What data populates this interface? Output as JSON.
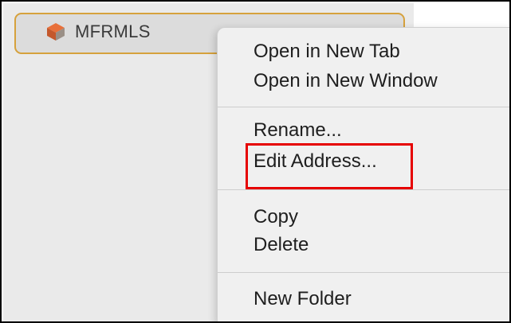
{
  "sidebar": {
    "bookmark": {
      "label": "MFRMLS",
      "icon": "mfrmls-logo-icon",
      "selected_border_color": "#d6a13c"
    }
  },
  "context_menu": {
    "groups": [
      {
        "items": [
          "Open in New Tab",
          "Open in New Window"
        ]
      },
      {
        "items": [
          "Rename...",
          "Edit Address..."
        ]
      },
      {
        "items": [
          "Copy",
          "Delete"
        ]
      },
      {
        "items": [
          "New Folder"
        ]
      }
    ]
  },
  "annotation": {
    "highlighted_item": "Edit Address...",
    "color": "#e60000"
  }
}
